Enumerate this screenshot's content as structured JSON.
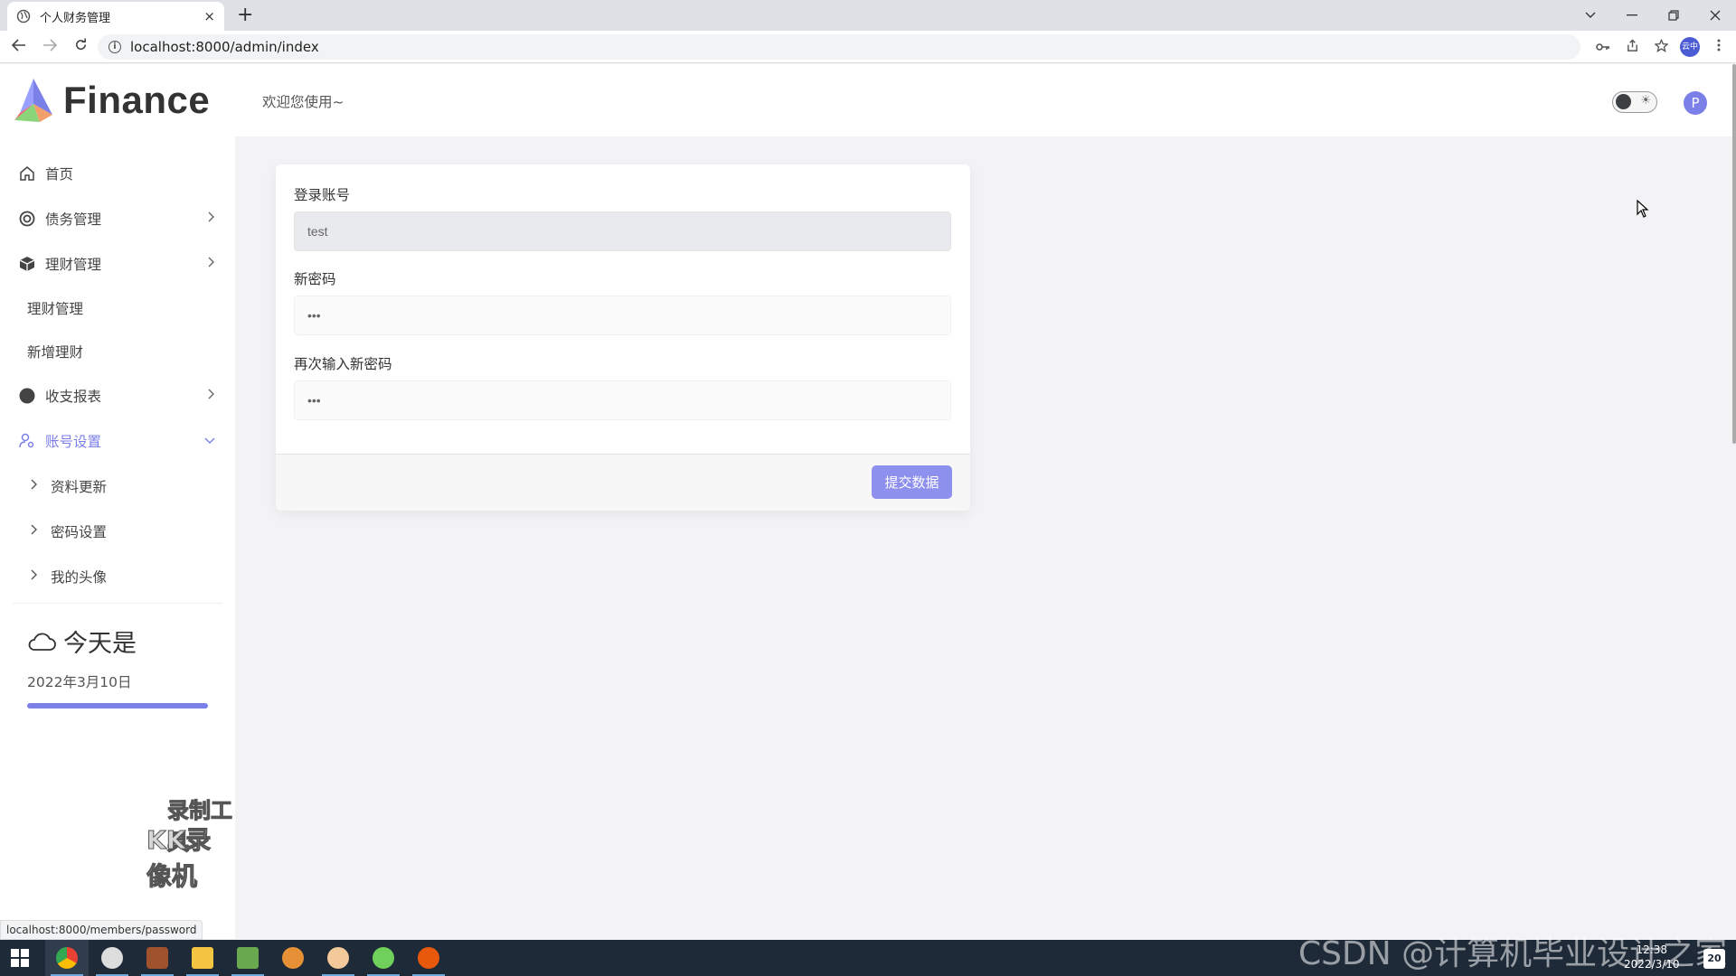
{
  "browser": {
    "tab_title": "个人财务管理",
    "tab_close": "×",
    "new_tab": "+",
    "url": "localhost:8000/admin/index",
    "status_url": "localhost:8000/members/password"
  },
  "app": {
    "brand": "Finance",
    "accent_color": "#7b7fe8",
    "welcome": "欢迎您使用~",
    "avatar_letter": "P"
  },
  "sidebar": {
    "items": [
      {
        "label": "首页",
        "icon": "home-icon"
      },
      {
        "label": "债务管理",
        "icon": "target-icon"
      },
      {
        "label": "理财管理",
        "icon": "cube-icon"
      },
      {
        "label": "理财管理",
        "icon": ""
      },
      {
        "label": "新增理财",
        "icon": ""
      },
      {
        "label": "收支报表",
        "icon": "circle-icon"
      },
      {
        "label": "账号设置",
        "icon": "user-settings-icon"
      },
      {
        "label": "资料更新",
        "icon": "chevron-right-icon"
      },
      {
        "label": "密码设置",
        "icon": "chevron-right-icon"
      },
      {
        "label": "我的头像",
        "icon": "chevron-right-icon"
      }
    ],
    "today_title": "今天是",
    "today_date": "2022年3月10日"
  },
  "form": {
    "account_label": "登录账号",
    "account_value": "test",
    "new_password_label": "新密码",
    "new_password_value": "•••",
    "confirm_password_label": "再次输入新密码",
    "confirm_password_value": "•••",
    "submit_label": "提交数据"
  },
  "overlay": {
    "recorder_line1": "录制工具",
    "recorder_line2": "KK录像机",
    "csdn_watermark": "CSDN @计算机毕业设计之家"
  },
  "taskbar": {
    "time": "12:38",
    "date": "2022/3/10",
    "notifications": "20"
  }
}
